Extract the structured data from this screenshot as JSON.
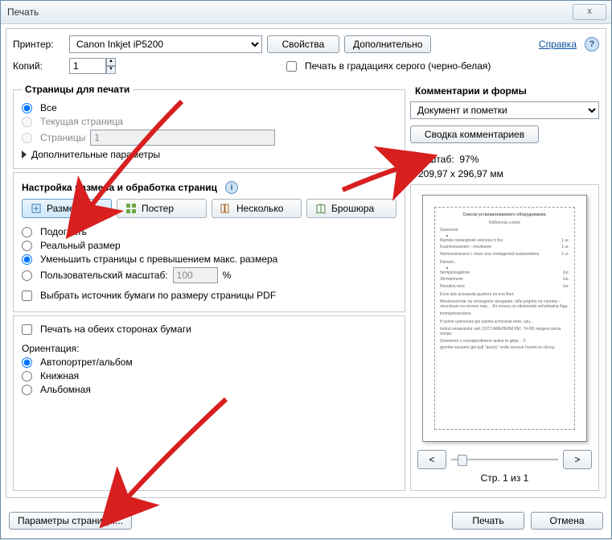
{
  "window": {
    "title": "Печать",
    "close": "x"
  },
  "top": {
    "printer_label": "Принтер:",
    "printer_value": "Canon Inkjet iP5200",
    "properties": "Свойства",
    "advanced": "Дополнительно",
    "help": "Справка",
    "copies_label": "Копий:",
    "copies_value": "1",
    "grayscale_label": "Печать в градациях серого (черно-белая)"
  },
  "pages": {
    "title": "Страницы для печати",
    "all": "Все",
    "current": "Текущая страница",
    "range_label": "Страницы",
    "range_value": "1",
    "more": "Дополнительные параметры"
  },
  "sizing": {
    "title": "Настройка размера и обработка страниц",
    "tabs": {
      "size": "Размер",
      "poster": "Постер",
      "multiple": "Несколько",
      "booklet": "Брошюра"
    },
    "fit": "Подогнать",
    "actual": "Реальный размер",
    "shrink": "Уменьшить страницы с превышением макс. размера",
    "custom_label": "Пользовательский масштаб:",
    "custom_value": "100",
    "percent": "%",
    "source_by_pdf": "Выбрать источник бумаги по размеру страницы PDF"
  },
  "duplex": {
    "both_sides": "Печать на обеих сторонах бумаги",
    "orientation_label": "Ориентация:",
    "auto": "Автопортрет/альбом",
    "portrait": "Книжная",
    "landscape": "Альбомная"
  },
  "comments": {
    "title": "Комментарии и формы",
    "dropdown": "Документ и пометки",
    "summary_btn": "Сводка комментариев"
  },
  "preview": {
    "scale_label": "Масштаб:",
    "scale_value": "97%",
    "dimensions": "209,97 x 296,97 мм",
    "page_indicator": "Стр. 1 из 1",
    "prev": "<",
    "next": ">"
  },
  "footer": {
    "page_setup": "Параметры страницы...",
    "print": "Печать",
    "cancel": "Отмена"
  }
}
